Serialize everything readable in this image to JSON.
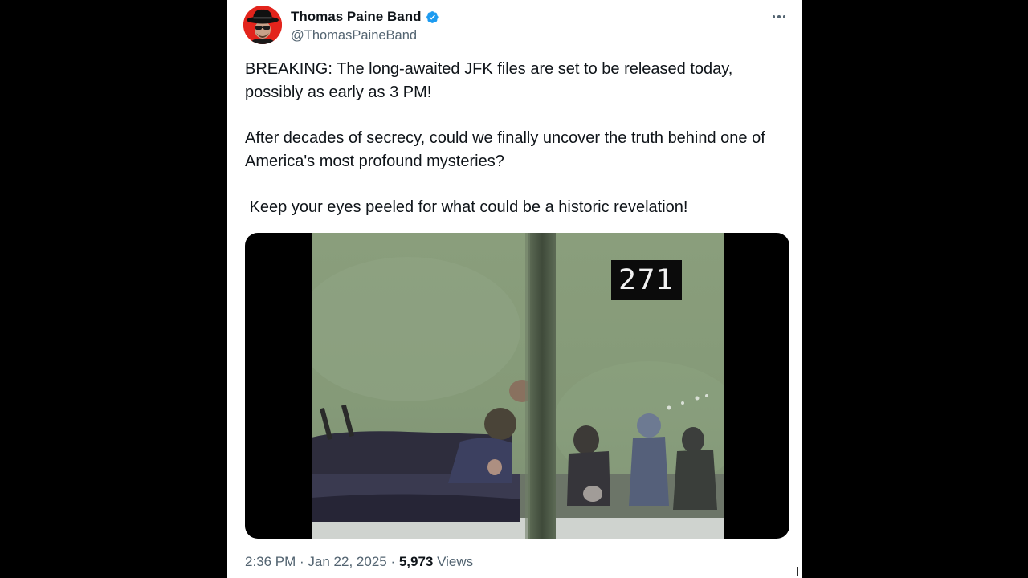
{
  "author": {
    "display_name": "Thomas Paine Band",
    "handle": "@ThomasPaineBand",
    "verified": true,
    "avatar_icon": "cowboy-hat-avatar",
    "avatar_bg": "#e3241c"
  },
  "menu": {
    "icon": "more-horizontal-icon"
  },
  "tweet": {
    "paragraphs": [
      "BREAKING: The long-awaited JFK files are set to be released today, possibly as early as 3 PM!",
      "After decades of secrecy, could we finally uncover the truth behind one of America's most profound mysteries?",
      " Keep your eyes peeled for what could be a historic revelation!"
    ]
  },
  "media": {
    "type": "video-still",
    "frame_counter": "271"
  },
  "meta": {
    "time": "2:36 PM",
    "separator": " · ",
    "date": "Jan 22, 2025",
    "views_count": "5,973",
    "views_label": "Views"
  },
  "colors": {
    "verified_blue": "#1d9bf0",
    "text_primary": "#0f1419",
    "text_secondary": "#536471"
  }
}
